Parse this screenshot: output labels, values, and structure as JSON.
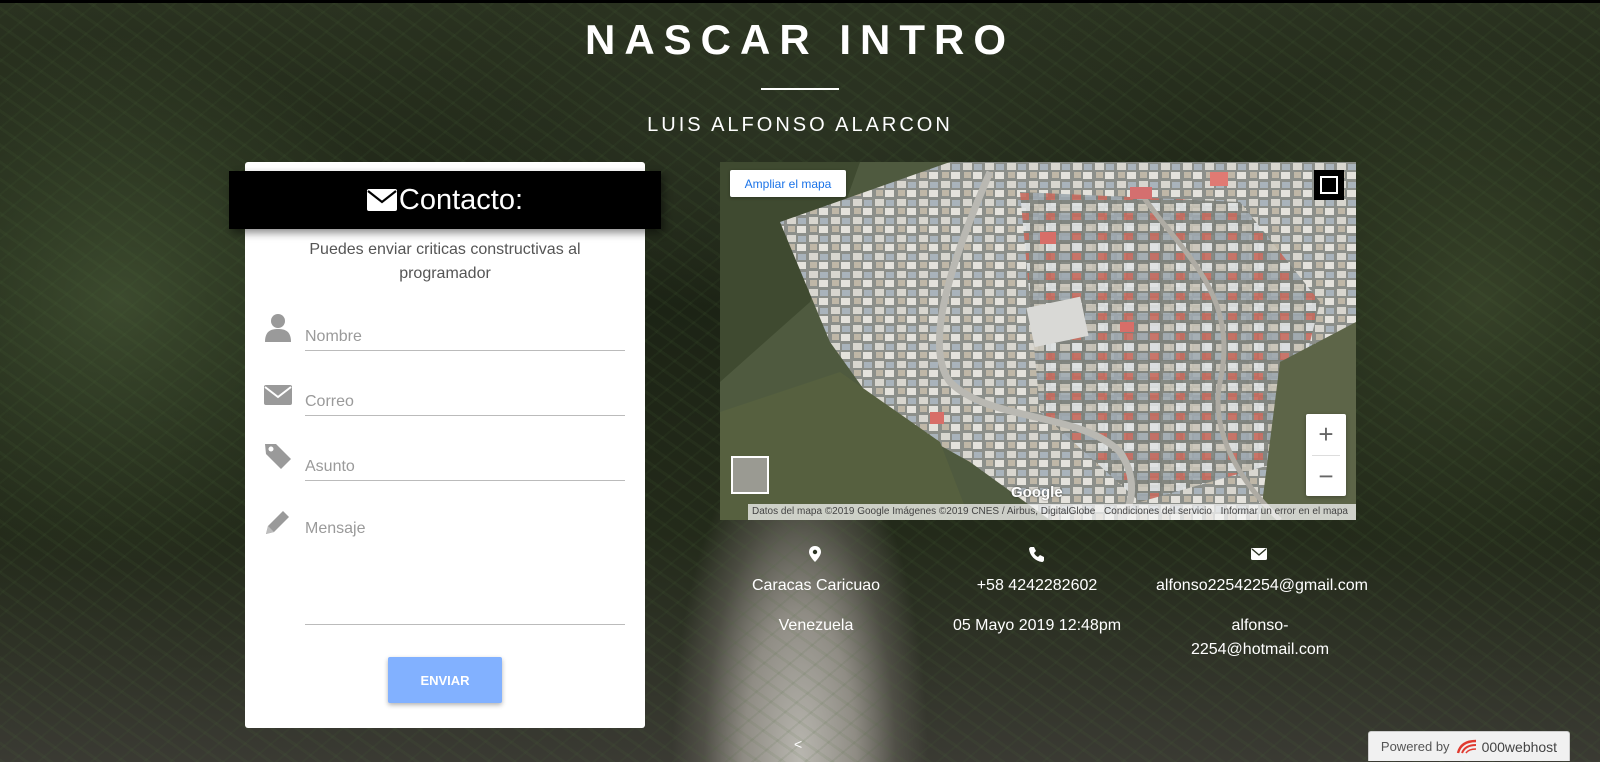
{
  "header": {
    "title": "NASCAR INTRO",
    "subtitle": "LUIS ALFONSO ALARCON"
  },
  "contact": {
    "heading": "Contacto:",
    "intro": "Puedes enviar criticas constructivas al programador",
    "fields": {
      "name_placeholder": "Nombre",
      "email_placeholder": "Correo",
      "subject_placeholder": "Asunto",
      "message_placeholder": "Mensaje"
    },
    "send_label": "ENVIAR"
  },
  "map": {
    "expand_label": "Ampliar el mapa",
    "zoom_in": "+",
    "zoom_out": "−",
    "logo": "Google",
    "attribution": "Datos del mapa ©2019 Google Imágenes ©2019 CNES / Airbus, DigitalGlobe",
    "terms": "Condiciones del servicio",
    "report": "Informar un error en el mapa"
  },
  "info": {
    "location": {
      "icon": "map-pin-icon",
      "city": "Caracas Caricuao",
      "country": "Venezuela"
    },
    "phone": {
      "icon": "phone-icon",
      "number": "+58 4242282602",
      "date": "05 Mayo 2019 12:48pm"
    },
    "email": {
      "icon": "envelope-icon",
      "primary": "alfonso22542254@gmail.com",
      "secondary": "alfonso-2254@hotmail.com"
    }
  },
  "footer": {
    "scroll_arrow": "<",
    "powered_by": "Powered by",
    "host_brand": "000webhost"
  },
  "colors": {
    "button_blue": "#82b1ff",
    "link_blue": "#1a73e8",
    "header_black": "#000000"
  }
}
